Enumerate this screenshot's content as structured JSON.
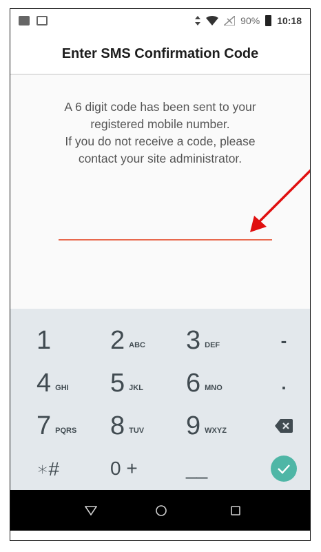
{
  "status_bar": {
    "battery_percent": "90%",
    "time": "10:18"
  },
  "header": {
    "title": "Enter SMS Confirmation Code"
  },
  "message": {
    "lines": [
      "A 6 digit code has been sent to your",
      "registered mobile number.",
      "If you do not receive a code, please",
      "contact your site administrator."
    ]
  },
  "code_input": {
    "value": "",
    "placeholder": ""
  },
  "keypad": {
    "k1": "1",
    "k2": "2",
    "k2_letters": "ABC",
    "k3": "3",
    "k3_letters": "DEF",
    "dash": "-",
    "k4": "4",
    "k4_letters": "GHI",
    "k5": "5",
    "k5_letters": "JKL",
    "k6": "6",
    "k6_letters": "MNO",
    "dot": ".",
    "k7": "7",
    "k7_letters": "PQRS",
    "k8": "8",
    "k8_letters": "TUV",
    "k9": "9",
    "k9_letters": "WXYZ",
    "star_hash": "∗#",
    "zero_plus": "0 +",
    "underscore": "__"
  },
  "colors": {
    "accent_underline": "#e8694e",
    "done_button": "#4fb6a6",
    "annotation_arrow": "#e01010",
    "keypad_bg": "#e3e8ec"
  },
  "icons": {
    "status_left": [
      "image-icon",
      "screenshot-icon"
    ],
    "status_right": [
      "data-arrows-icon",
      "wifi-icon",
      "no-signal-icon",
      "battery-icon"
    ],
    "keypad": [
      "backspace-icon",
      "checkmark-icon"
    ],
    "nav": [
      "back-triangle-icon",
      "home-circle-icon",
      "recents-square-icon"
    ]
  }
}
